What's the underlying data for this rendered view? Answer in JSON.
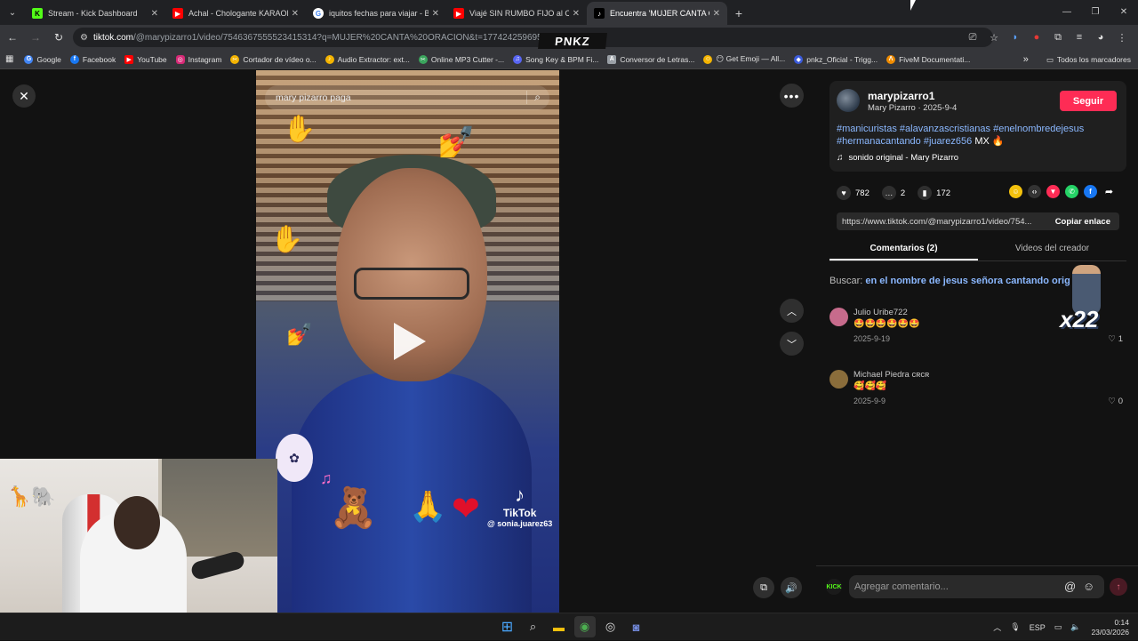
{
  "browser": {
    "tabs": [
      {
        "title": "Stream - Kick Dashboard",
        "icon": "kick-icon",
        "color": "#53fc18"
      },
      {
        "title": "Achal - Chologante KARAOKE (",
        "icon": "youtube-icon",
        "color": "#ff0000"
      },
      {
        "title": "iquitos fechas para viajar - Busc",
        "icon": "google-icon",
        "color": "#4285f4"
      },
      {
        "title": "Viajé SIN RUMBO FIJO al Corazó",
        "icon": "youtube-icon",
        "color": "#ff0000"
      },
      {
        "title": "Encuentra 'MUJER CANTA ORAC",
        "icon": "tiktok-icon",
        "color": "#ffffff",
        "active": true
      }
    ],
    "url_host": "tiktok.com",
    "url_path": "/@marypizarro1/video/7546367555523415314?q=MUJER%20CANTA%20ORACION&t=1774242596951",
    "overlay_logo": "PNKZ",
    "bookmarks": [
      {
        "label": "Google",
        "icon": "google-icon",
        "color": "#4285f4"
      },
      {
        "label": "Facebook",
        "icon": "facebook-icon",
        "color": "#1877f2"
      },
      {
        "label": "YouTube",
        "icon": "youtube-icon",
        "color": "#ff0000"
      },
      {
        "label": "Instagram",
        "icon": "instagram-icon",
        "color": "#d62976"
      },
      {
        "label": "Cortador de vídeo o...",
        "icon": "scissors-icon",
        "color": "#f4b400"
      },
      {
        "label": "Audio Extractor: ext...",
        "icon": "audio-icon",
        "color": "#f4b400"
      },
      {
        "label": "Online MP3 Cutter -...",
        "icon": "mp3-icon",
        "color": "#3ba55d"
      },
      {
        "label": "Song Key & BPM Fi...",
        "icon": "music-icon",
        "color": "#5865f2"
      },
      {
        "label": "Conversor de Letras...",
        "icon": "letters-icon",
        "color": "#9aa0a6"
      },
      {
        "label": "😶 Get Emoji — All...",
        "icon": "emoji-icon",
        "color": "#f4b400"
      },
      {
        "label": "pnkz_Oficial - Trigg...",
        "icon": "trigger-icon",
        "color": "#3b5bdb"
      },
      {
        "label": "FiveM Documentati...",
        "icon": "fivem-icon",
        "color": "#f08c00"
      }
    ],
    "bookmarks_more": "»",
    "all_bookmarks": "Todos los marcadores"
  },
  "video": {
    "search_text": "mary pizarro paga",
    "watermark_brand": "TikTok",
    "watermark_user": "@ sonia.juarez63"
  },
  "creator": {
    "username": "marypizarro1",
    "nickname_date": "Mary Pizarro · 2025-9-4",
    "follow_label": "Seguir",
    "caption": "#manicuristas #alavanzascristianas #enelnombredejesus #hermanacantando #juarez656",
    "caption_suffix": "MX 🔥",
    "music": "sonido original - Mary Pizarro"
  },
  "stats": {
    "likes": "782",
    "comments": "2",
    "saves": "172"
  },
  "share": {
    "link": "https://www.tiktok.com/@marypizarro1/video/754...",
    "copy_label": "Copiar enlace"
  },
  "panel_tabs": {
    "comments": "Comentarios (2)",
    "creator_videos": "Videos del creador"
  },
  "search_suggestion": {
    "prefix": "Buscar:",
    "query": "en el nombre de jesus señora cantando original"
  },
  "overlay_badge": "x22",
  "comments": [
    {
      "name": "Julio Uribe722",
      "text": "🤩🤩🤩🤩🤩🤩",
      "date": "2025-9-19",
      "likes": "1",
      "avatar_color": "#c76b8c"
    },
    {
      "name": "Michael Piedra ᴄʀᴄʀ",
      "text": "🥰🥰🥰",
      "date": "2025-9-9",
      "likes": "0",
      "avatar_color": "#8a6d3b"
    }
  ],
  "comment_box": {
    "placeholder": "Agregar comentario...",
    "kick_badge": "KICK"
  },
  "taskbar": {
    "lang": "ESP",
    "time": "0:14",
    "date": "23/03/2026"
  }
}
